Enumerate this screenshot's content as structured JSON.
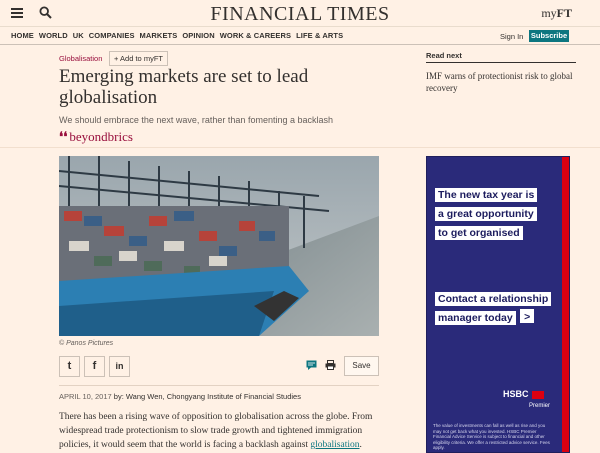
{
  "header": {
    "masthead": "FINANCIAL TIMES",
    "myft_prefix": "my",
    "myft_suffix": "FT"
  },
  "nav": {
    "items": [
      "HOME",
      "WORLD",
      "UK",
      "COMPANIES",
      "MARKETS",
      "OPINION",
      "WORK & CAREERS",
      "LIFE & ARTS"
    ],
    "sign_in": "Sign In",
    "subscribe": "Subscribe"
  },
  "article": {
    "section": "Globalisation",
    "add_myft": "+ Add to myFT",
    "headline": "Emerging markets are set to lead globalisation",
    "standfirst": "We should embrace the next wave, rather than fomenting a backlash",
    "brand": "beyondbrics",
    "caption": "© Panos Pictures",
    "save": "Save",
    "date": "APRIL 10, 2017",
    "byline": " by: Wang Wen, Chongyang Institute of Financial Studies",
    "body_text": "There has been a rising wave of opposition to globalisation across the globe. From widespread trade protectionism to slow trade growth and tightened immigration policies, it would seem that the world is facing a backlash against ",
    "body_link": "globalisation",
    "body_end": "."
  },
  "share": {
    "twitter": "t",
    "facebook": "f",
    "linkedin": "in"
  },
  "read_next": {
    "label": "Read next",
    "title": "IMF warns of protectionist risk to global recovery"
  },
  "ad": {
    "lines1": [
      "The new tax year is",
      "a great opportunity",
      "to get organised"
    ],
    "lines2": [
      "Contact a relationship",
      "manager today"
    ],
    "arrow": ">",
    "logo": "HSBC",
    "premier": "Premier",
    "small_print": "The value of investments can fall as well as rise and you may not get back what you invested. HSBC Premier Financial Advice Service is subject to financial and other eligibility criteria. We offer a restricted advice service. Fees apply."
  },
  "colors": {
    "background": "#fff1e5",
    "accent": "#990f3d",
    "teal": "#0d7680",
    "ad_blue": "#2a2a7a",
    "hsbc_red": "#db0011"
  }
}
